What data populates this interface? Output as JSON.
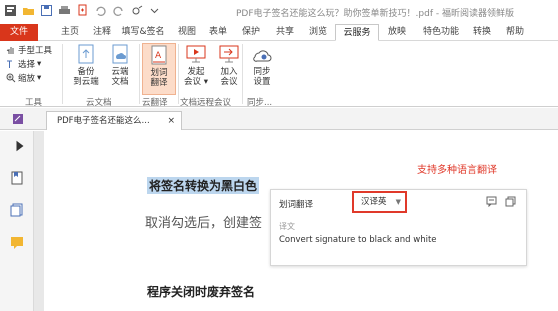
{
  "window": {
    "title": "PDF电子签名还能这么玩？助你签单新技巧！.pdf - 福昕阅读器领鲜版"
  },
  "menu": {
    "tabs": [
      "文件",
      "主页",
      "注释",
      "填写&签名",
      "视图",
      "表单",
      "保护",
      "共享",
      "浏览",
      "云服务",
      "放映",
      "特色功能",
      "转换",
      "帮助"
    ]
  },
  "ribbon": {
    "tools": {
      "hand": "手型工具",
      "select": "选择",
      "zoom": "缩放",
      "label": "工具"
    },
    "cloud_doc": {
      "backup": [
        "备份",
        "到云端"
      ],
      "cloud": [
        "云端",
        "文档"
      ],
      "label": "云文档"
    },
    "cloud_translate": {
      "translate": [
        "划词",
        "翻译"
      ],
      "label": "云翻译"
    },
    "remote_meeting": {
      "start": [
        "发起",
        "会议"
      ],
      "join": [
        "加入",
        "会议"
      ],
      "label": "文档远程会议"
    },
    "sync": {
      "settings": [
        "同步",
        "设置"
      ],
      "label": "同步..."
    }
  },
  "doc_tab": {
    "title": "PDF电子签名还能这么...",
    "close": "×"
  },
  "document": {
    "heading1": "将签名转换为黑白色",
    "body": "取消勾选后，创建签",
    "heading2": "程序关闭时废弃签名"
  },
  "annotation": "支持多种语言翻译",
  "translate_popup": {
    "title": "划词翻译",
    "language": "汉译英",
    "subtitle": "译文",
    "result": "Convert signature to black and white"
  },
  "colors": {
    "accent": "#d9361b",
    "highlight": "#bcd6ee",
    "annotation": "#e0392a"
  }
}
